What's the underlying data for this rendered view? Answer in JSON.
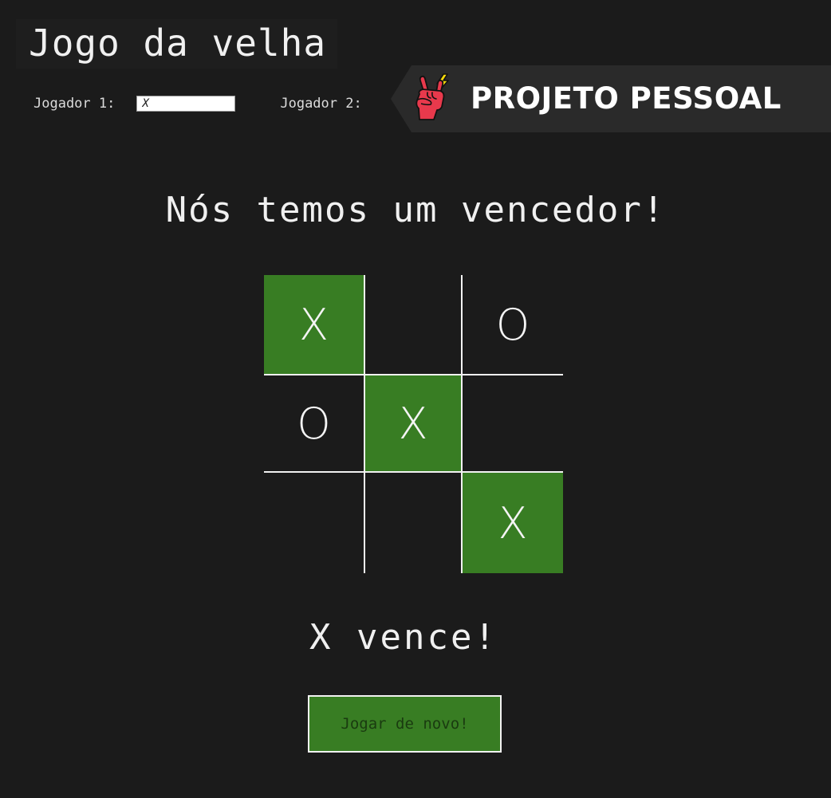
{
  "app": {
    "title": "Jogo da velha"
  },
  "players": {
    "player1_label": "Jogador 1:",
    "player1_value": "X",
    "player2_label": "Jogador 2:"
  },
  "banner": {
    "text": "PROJETO PESSOAL",
    "icon": "rock-hand-icon"
  },
  "status": {
    "heading": "Nós temos um vencedor!",
    "result": "X vence!"
  },
  "board": {
    "cells": [
      {
        "mark": "X",
        "winning": true
      },
      {
        "mark": "",
        "winning": false
      },
      {
        "mark": "O",
        "winning": false
      },
      {
        "mark": "O",
        "winning": false
      },
      {
        "mark": "X",
        "winning": true
      },
      {
        "mark": "",
        "winning": false
      },
      {
        "mark": "",
        "winning": false
      },
      {
        "mark": "",
        "winning": false
      },
      {
        "mark": "X",
        "winning": true
      }
    ]
  },
  "actions": {
    "replay_label": "Jogar de novo!"
  },
  "colors": {
    "background": "#1b1b1b",
    "win_cell": "#387d23",
    "grid_line": "#f2f2f2",
    "banner_bg": "#2a2a2a",
    "hand_icon": "#e8394c",
    "lightning": "#f5d90a"
  }
}
